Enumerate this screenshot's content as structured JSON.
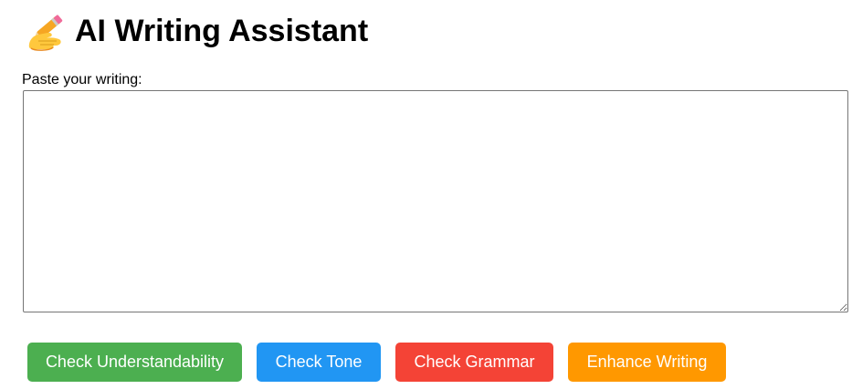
{
  "header": {
    "icon": "writing-hand-icon",
    "title": "AI Writing Assistant"
  },
  "editor": {
    "label": "Paste your writing:",
    "value": "",
    "placeholder": ""
  },
  "actions": [
    {
      "label": "Check Understandability",
      "color": "#4caf50"
    },
    {
      "label": "Check Tone",
      "color": "#2196f3"
    },
    {
      "label": "Check Grammar",
      "color": "#f44336"
    },
    {
      "label": "Enhance Writing",
      "color": "#ff9800"
    }
  ],
  "colors": {
    "background": "#ffffff",
    "text": "#000000",
    "editor_border": "#767676",
    "button_text": "#ffffff"
  }
}
